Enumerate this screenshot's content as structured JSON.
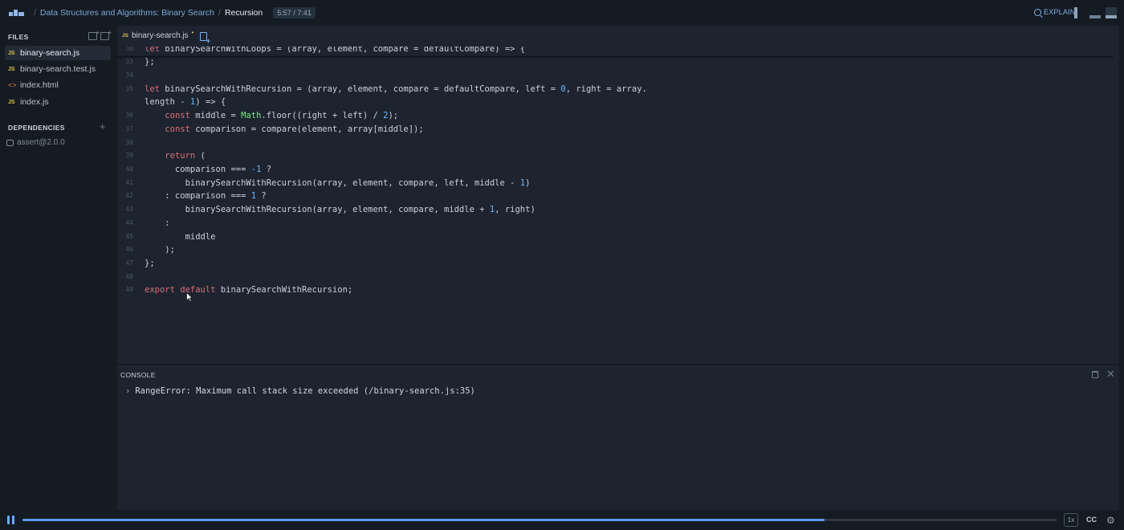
{
  "header": {
    "breadcrumb_separator": "/",
    "course": "Data Structures and Algorithms: Binary Search",
    "lesson": "Recursion",
    "time": "5:57 / 7:41",
    "explain_label": "EXPLAIN"
  },
  "sidebar": {
    "files_label": "FILES",
    "files": [
      {
        "icon": "JS",
        "name": "binary-search.js",
        "active": true
      },
      {
        "icon": "JS",
        "name": "binary-search.test.js",
        "active": false
      },
      {
        "icon": "<>",
        "name": "index.html",
        "active": false
      },
      {
        "icon": "JS",
        "name": "index.js",
        "active": false
      }
    ],
    "dependencies_label": "DEPENDENCIES",
    "add_symbol": "+",
    "dependencies": [
      "assert@2.0.0"
    ]
  },
  "editor": {
    "tab_icon": "JS",
    "tab_name": "binary-search.js",
    "tab_modified": "•",
    "lines": [
      {
        "n": "30",
        "html": "<span class=\"kw\">let</span> binarySearchWithLoops = (array, element, compare = defaultCompare) => {"
      },
      {
        "n": "33",
        "html": "};"
      },
      {
        "n": "34",
        "html": ""
      },
      {
        "n": "35",
        "html": "<span class=\"kw\">let</span> binarySearchWithRecursion = (array, element, compare = defaultCompare, left = <span class=\"num\">0</span>, right = array."
      },
      {
        "n": "",
        "html": "length - <span class=\"num\">1</span>) => {"
      },
      {
        "n": "36",
        "html": "    <span class=\"kw\">const</span> middle = <span class=\"mth\">Math</span>.floor((right + left) / <span class=\"num\">2</span>);"
      },
      {
        "n": "37",
        "html": "    <span class=\"kw\">const</span> comparison = compare(element, array[middle]);"
      },
      {
        "n": "38",
        "html": ""
      },
      {
        "n": "39",
        "html": "    <span class=\"kw\">return</span> ("
      },
      {
        "n": "40",
        "html": "      comparison === <span class=\"num\">-1</span> ?"
      },
      {
        "n": "41",
        "html": "        binarySearchWithRecursion(array, element, compare, left, middle - <span class=\"num\">1</span>)"
      },
      {
        "n": "42",
        "html": "    : comparison === <span class=\"num\">1</span> ?"
      },
      {
        "n": "43",
        "html": "        binarySearchWithRecursion(array, element, compare, middle + <span class=\"num\">1</span>, right)"
      },
      {
        "n": "44",
        "html": "    :"
      },
      {
        "n": "45",
        "html": "        middle"
      },
      {
        "n": "46",
        "html": "    );"
      },
      {
        "n": "47",
        "html": "};"
      },
      {
        "n": "48",
        "html": ""
      },
      {
        "n": "49",
        "html": "<span class=\"kw\">export</span> <span class=\"kw\">default</span> binarySearchWithRecursion;"
      }
    ]
  },
  "console": {
    "label": "CONSOLE",
    "chevron": "›",
    "message": "RangeError: Maximum call stack size exceeded (/binary-search.js:35)",
    "close_symbol": "✕"
  },
  "player": {
    "progress": 0.776,
    "cc_label": "CC",
    "speed_label": "1x"
  }
}
